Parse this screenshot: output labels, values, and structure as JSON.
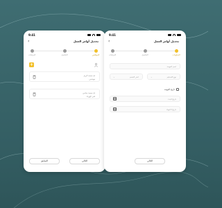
{
  "colors": {
    "background": "#3f6d72",
    "accent": "#f2c02a",
    "card": "#ffffff"
  },
  "left_screen": {
    "status_time": "9:41",
    "title": "تحديل أوامر العمل",
    "steps": [
      {
        "label": "المرفقات",
        "state": "done"
      },
      {
        "label": "التفاصيل",
        "state": "done"
      },
      {
        "label": "الموظفين",
        "state": "active"
      }
    ],
    "cards": [
      {
        "line1": "م/ محمد كريم",
        "line2": "مهندس"
      },
      {
        "line1": "م/ محمد سامي",
        "line2": "فني كهرباء"
      }
    ],
    "buttons": {
      "back_label": "السابق",
      "next_label": "التالي"
    }
  },
  "right_screen": {
    "status_time": "9:41",
    "title": "تحديل أوامر العمل",
    "steps": [
      {
        "label": "المرفقات",
        "state": "done"
      },
      {
        "label": "التفاصيل",
        "state": "done"
      },
      {
        "label": "المعلومات",
        "state": "active"
      }
    ],
    "fields": {
      "name_placeholder": "اسم المهمة",
      "type_placeholder": "نوع التسليم",
      "dept_placeholder": "اختر القسم",
      "date_label": "تاريخ المهمة",
      "start_placeholder": "تاريخ البدء",
      "end_placeholder": "تاريخ الانتهاء"
    },
    "buttons": {
      "next_label": "التالي"
    }
  }
}
